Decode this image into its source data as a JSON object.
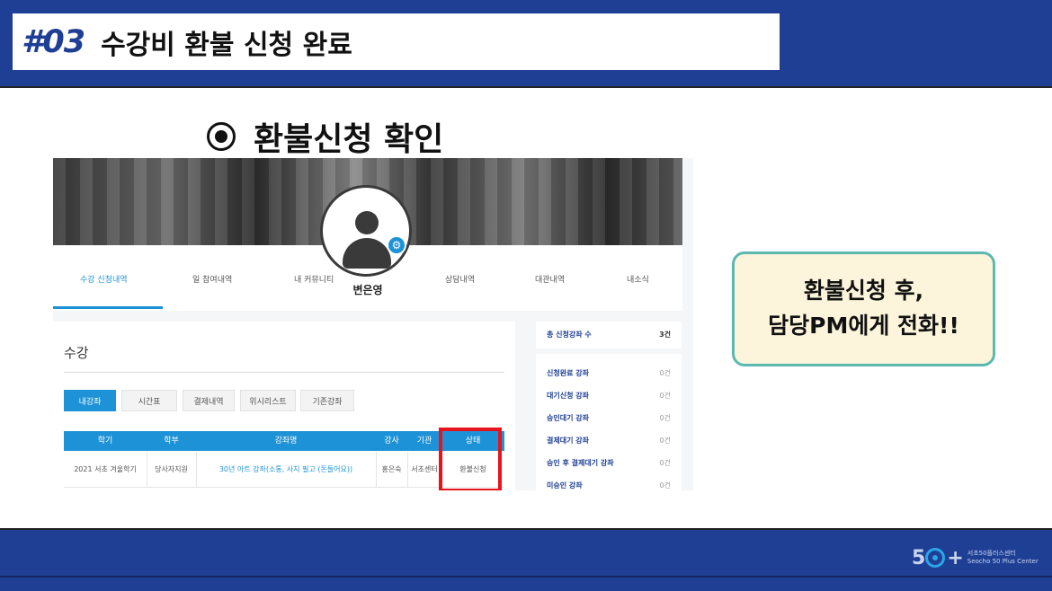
{
  "slide": {
    "number": "#03",
    "title": "수강비 환불 신청 완료",
    "heading": "환불신청 확인",
    "callout_line1": "환불신청 후,",
    "callout_line2": "담당PM에게 전화!!"
  },
  "colors": {
    "brand_blue": "#1f3f95",
    "accent_blue": "#1d92d6",
    "highlight_red": "#e8141d",
    "callout_border": "#5bb9b0",
    "callout_bg": "#fcf5dc"
  },
  "screenshot": {
    "username": "변은영",
    "tabs": [
      "수강 신청내역",
      "일 참여내역",
      "내 커뮤니티",
      "상담내역",
      "대관내역",
      "내소식"
    ],
    "section_title": "수강",
    "subtabs": [
      "내강좌",
      "시간표",
      "결제내역",
      "위시리스트",
      "기존강좌"
    ],
    "table_headers": [
      "학기",
      "학부",
      "강좌명",
      "강사",
      "기관",
      "상태"
    ],
    "row": [
      "2021 서초 겨울학기",
      "당사자지원",
      "30년 아트 강좌(소통, 사지 필고 (돈들어요))",
      "홍은숙",
      "서초센터",
      "환불신청"
    ],
    "side_top": {
      "label": "총 신청강좌 수",
      "value": "3건"
    },
    "side_items": [
      {
        "label": "신청완료 강좌",
        "count": "0건"
      },
      {
        "label": "대기신청 강좌",
        "count": "0건"
      },
      {
        "label": "승인대기 강좌",
        "count": "0건"
      },
      {
        "label": "결제대기 강좌",
        "count": "0건"
      },
      {
        "label": "승인 후 결제대기 강좌",
        "count": "0건"
      },
      {
        "label": "미승인 강좌",
        "count": "0건"
      }
    ]
  },
  "logo": {
    "mark": "5",
    "plus": "+",
    "text1": "서초50플러스센터",
    "text2": "Seocho 50 Plus Center"
  },
  "icons": [
    "target-icon",
    "avatar-icon",
    "gear-icon",
    "logo-ring-icon"
  ]
}
